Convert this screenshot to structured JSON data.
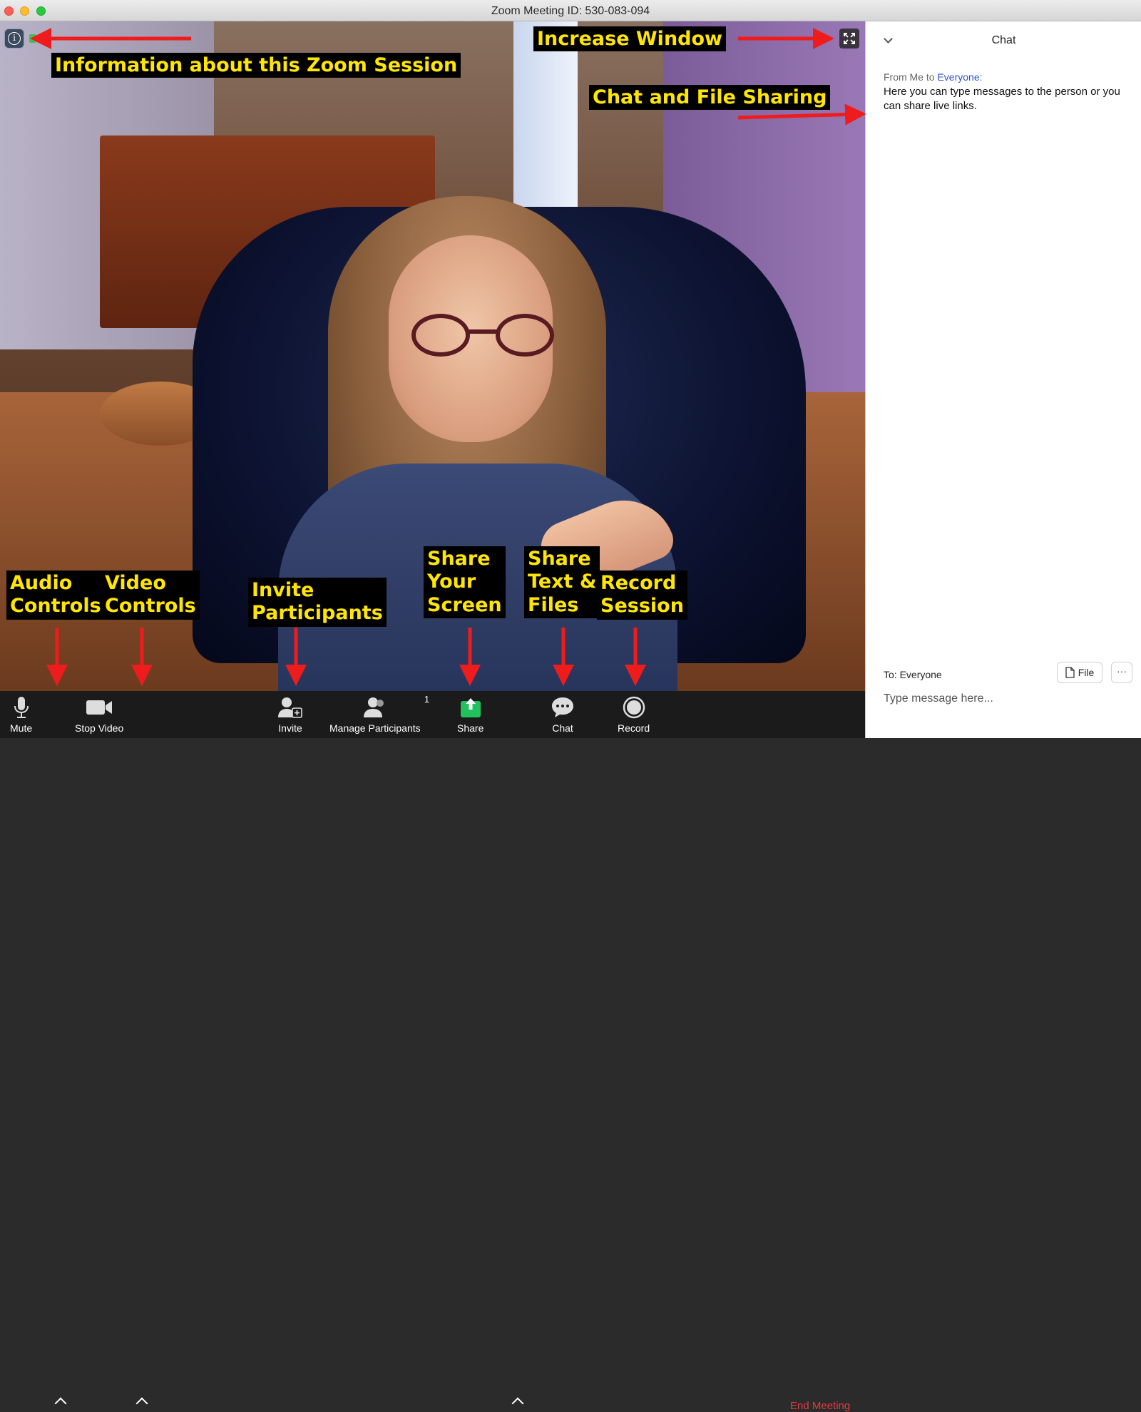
{
  "window": {
    "title": "Zoom Meeting ID: 530-083-094"
  },
  "annotations": {
    "info": "Information about this Zoom Session",
    "increase": "Increase Window",
    "chat_files": "Chat and File Sharing",
    "audio": "Audio\nControls",
    "video": "Video\nControls",
    "invite": "Invite\nParticipants",
    "share_screen": "Share\nYour\nScreen",
    "share_text": "Share\nText &\nFiles",
    "record": "Record\nSession"
  },
  "toolbar": {
    "mute": "Mute",
    "stop_video": "Stop Video",
    "invite": "Invite",
    "manage_participants": "Manage Participants",
    "participant_count": "1",
    "share": "Share",
    "chat": "Chat",
    "record": "Record",
    "end_meeting": "End Meeting"
  },
  "chat": {
    "title": "Chat",
    "from_prefix": "From Me to ",
    "from_recipient": "Everyone:",
    "message": "Here you can type messages to the person or you can share live links.",
    "to_label": "To: Everyone",
    "file_button": "File",
    "more_button": "···",
    "input_placeholder": "Type message here..."
  },
  "colors": {
    "annotation_bg": "#000000",
    "annotation_text": "#ffe600",
    "arrow": "#ee1c1c",
    "end_meeting": "#e8383b",
    "share_green": "#21c25e"
  }
}
